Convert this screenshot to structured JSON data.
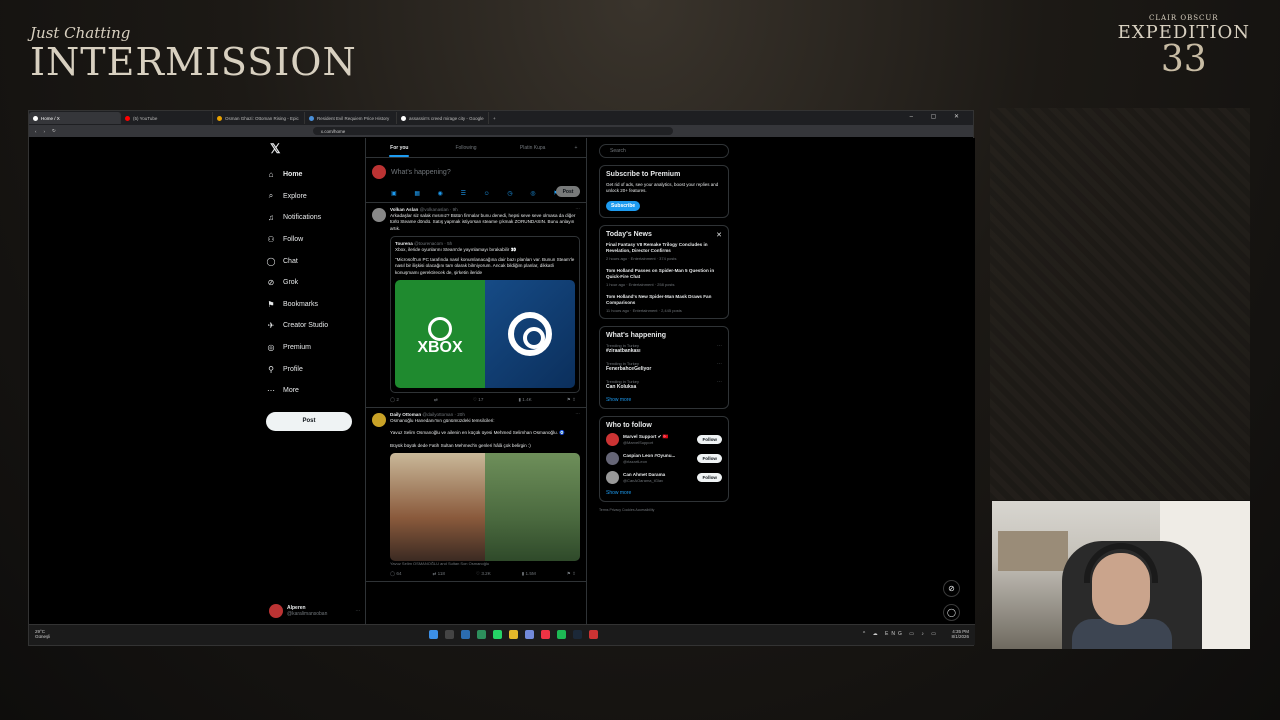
{
  "overlay": {
    "subtitle": "Just Chatting",
    "title": "INTERMISSION",
    "game_line1": "CLAIR OBSCUR",
    "game_line2": "EXPEDITION",
    "game_line3": "33"
  },
  "browser": {
    "tabs": [
      {
        "label": "Home / X",
        "color": "#ffffff",
        "active": true
      },
      {
        "label": "(5) YouTube",
        "color": "#ff0000"
      },
      {
        "label": "Osman Ghazi: Ottoman Rising - Epic",
        "color": "#e8a100"
      },
      {
        "label": "Resident Evil Requiem Price History",
        "color": "#4a90d9"
      },
      {
        "label": "assassin's creed mirage city - Google",
        "color": "#ffffff"
      }
    ],
    "new_tab": "+",
    "window_controls": "– ▢ ✕",
    "url": "x.com/home"
  },
  "nav": {
    "logo": "𝕏",
    "items": [
      {
        "label": "Home",
        "icon": "⌂"
      },
      {
        "label": "Explore",
        "icon": "⌕"
      },
      {
        "label": "Notifications",
        "icon": "♫"
      },
      {
        "label": "Follow",
        "icon": "⚇"
      },
      {
        "label": "Chat",
        "icon": "◯"
      },
      {
        "label": "Grok",
        "icon": "⊘"
      },
      {
        "label": "Bookmarks",
        "icon": "⚑"
      },
      {
        "label": "Creator Studio",
        "icon": "✈"
      },
      {
        "label": "Premium",
        "icon": "◎"
      },
      {
        "label": "Profile",
        "icon": "⚲"
      },
      {
        "label": "More",
        "icon": "⋯"
      }
    ],
    "post_button": "Post",
    "account_name": "Alperen",
    "account_handle": "@karalimansoban"
  },
  "feed": {
    "tabs": [
      "For you",
      "Following",
      "Platin Kupa",
      "+"
    ],
    "compose_placeholder": "What's happening?",
    "compose_post": "Post",
    "tweets": [
      {
        "name": "Volkan Aslan",
        "handle": "@volkanaslan · 9h",
        "text": "Arkadaşlar siz salak mısınız? Bütün firmalar bunu denedi, hepsi seve seve olmasa da diğer türlü Steame döndü. Satış yapmak istiyorsan steame çıkmak ZORUNDASIN. Bunu anlayın artık.",
        "quote_name": "Tourena",
        "quote_handle": "@tourenacom · 5h",
        "quote_text1": "Xbox, ileride oyunlarını Steam'de yayınlamayı bırakabilir 👀",
        "quote_text2": "\"Microsoft'un PC tarafında nasıl konumlanacağına dair bazı planları var. Bunun Steam'le nasıl bir ilişkisi olacağını tam olarak bilmiyorum. Ancak bildiğim planlar, dikkatli konuşmamı gerektirecek de, şirketin ileride",
        "media_left": "XBOX",
        "actions": [
          "◯ 2",
          "⇄",
          "♡ 17",
          "▮ 1.4K",
          "⚑ ⇪"
        ]
      },
      {
        "name": "Daily Ottoman",
        "handle": "@dailyottoman · 20h",
        "text1": "Osmanoğlu Hanedanı'nın günümüzdeki temsilcileri:",
        "text2": "Yavuz Selim Osmanoğlu ve ailenin en küçük üyesi Mehmed Selimhan Osmanoğlu. 🧿",
        "text3": "Büyük büyük dede Fatih Sultan Mehmed'in genleri hâlâ çok belirgin :)",
        "caption": "Yavuz Selim OSMANOĞLU and Sultan Son Osmanoğlu",
        "actions": [
          "◯ 64",
          "⇄ 118",
          "♡ 3.2K",
          "▮ 1.5M",
          "⚑ ⇪"
        ]
      }
    ]
  },
  "sidebar": {
    "search_placeholder": "Search",
    "premium_title": "Subscribe to Premium",
    "premium_text": "Get rid of ads, see your analytics, boost your replies and unlock 20+ features.",
    "premium_button": "Subscribe",
    "news_title": "Today's News",
    "news_close": "✕",
    "news": [
      {
        "title": "Final Fantasy VII Remake Trilogy Concludes in Revelation, Director Confirms",
        "meta": "2 hours ago · Entertainment · 374 posts"
      },
      {
        "title": "Tom Holland Passes on Spider-Man 5 Question in Quick-Fire Chat",
        "meta": "1 hour ago · Entertainment · 258 posts"
      },
      {
        "title": "Tom Holland's New Spider-Man Mask Draws Fan Comparisons",
        "meta": "11 hours ago · Entertainment · 2,445 posts"
      }
    ],
    "happening_title": "What's happening",
    "trends": [
      {
        "context": "Trending in Turkey",
        "name": "#ziraatbankası"
      },
      {
        "context": "Trending in Turkey",
        "name": "FenerbahceGeliyor"
      },
      {
        "context": "Trending in Turkey",
        "name": "Can Koluksa"
      }
    ],
    "show_more": "Show more",
    "follow_title": "Who to follow",
    "follows": [
      {
        "name": "Marvel Support ✔ 🇹🇷",
        "handle": "@MarvelSupport"
      },
      {
        "name": "Caspian Leon #Oyunu...",
        "handle": "@rlazartLeon"
      },
      {
        "name": "Can Ahmet Darama",
        "handle": "@CanAOarama_tGlav"
      }
    ],
    "follow_button": "Follow",
    "footer": "Terms    Privacy    Cookies    Accessibility"
  },
  "taskbar": {
    "weather_temp": "29°C",
    "weather_desc": "Güneşli",
    "tray_icons": "^ ☁ ENG ▭ ♪ ▭",
    "time": "4:35 PM",
    "date": "8/1/2026"
  },
  "colors": {
    "accent": "#1d9bf0",
    "xbox_green": "#1f8a2f",
    "steam_blue": "#164b86"
  }
}
